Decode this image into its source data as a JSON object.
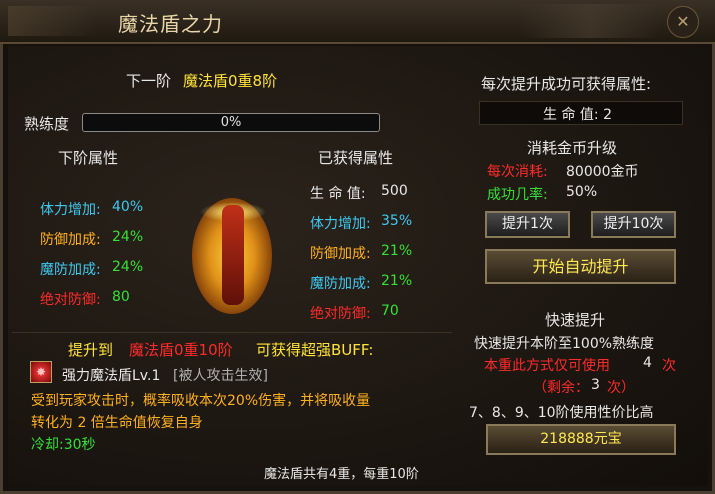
{
  "window": {
    "title": "魔法盾之力",
    "close_label": "✕"
  },
  "header": {
    "prefix": "下一阶",
    "next_level": "魔法盾0重8阶"
  },
  "proficiency": {
    "label": "熟练度",
    "value": "0%"
  },
  "next_attrs": {
    "title": "下阶属性",
    "rows": [
      {
        "name": "体力增加:",
        "value": "40%"
      },
      {
        "name": "防御加成:",
        "value": "24%"
      },
      {
        "name": "魔防加成:",
        "value": "24%"
      },
      {
        "name": "绝对防御:",
        "value": "80"
      }
    ]
  },
  "got_attrs": {
    "title": "已获得属性",
    "rows": [
      {
        "name": "生 命 值:",
        "value": "500"
      },
      {
        "name": "体力增加:",
        "value": "35%"
      },
      {
        "name": "防御加成:",
        "value": "21%"
      },
      {
        "name": "魔防加成:",
        "value": "21%"
      },
      {
        "name": "绝对防御:",
        "value": "70"
      }
    ]
  },
  "buff": {
    "prefix": "提升到",
    "target": "魔法盾0重10阶",
    "suffix": "可获得超强BUFF:",
    "name": "强力魔法盾Lv.1",
    "tag": "[被人攻击生效]",
    "desc1": "受到玩家攻击时，概率吸收本次20%伤害，并将吸收量",
    "desc2": "转化为 2 倍生命值恢复自身",
    "cooldown": "冷却:30秒"
  },
  "footer": "魔法盾共有4重，每重10阶",
  "right": {
    "gain_title": "每次提升成功可获得属性:",
    "gain_value": "生 命 值: 2",
    "cost_title": "消耗金币升级",
    "cost_label": "每次消耗:",
    "cost_value": "80000金币",
    "rate_label": "成功几率:",
    "rate_value": "50%",
    "btn_once": "提升1次",
    "btn_ten": "提升10次",
    "btn_auto": "开始自动提升",
    "quick_title": "快速提升",
    "quick_desc": "快速提升本阶至100%熟练度",
    "limit_prefix": "本重此方式仅可使用",
    "limit_count": "4",
    "limit_unit": "次",
    "remain_prefix": "（剩余：",
    "remain_count": "3",
    "remain_suffix": "次）",
    "value_note": "7、8、9、10阶使用性价比高",
    "price_btn": "218888元宝"
  }
}
